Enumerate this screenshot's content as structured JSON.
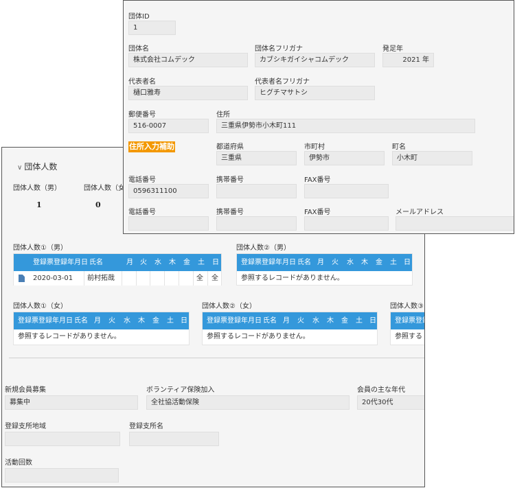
{
  "back": {
    "section_title": "団体人数",
    "count_male_label": "団体人数（男）",
    "count_female_label": "団体人数（女",
    "count_male_value": "1",
    "count_female_value": "0",
    "sub1_title": "団体人数①（男）",
    "sub2_title": "団体人数②（男）",
    "sub3_title": "団体人数①（女）",
    "sub4_title": "団体人数②（女）",
    "sub5_title": "団体人数③",
    "headers": [
      "登録票登録年月日",
      "氏名",
      "月",
      "火",
      "水",
      "木",
      "金",
      "土",
      "日"
    ],
    "row1": {
      "date": "2020-03-01",
      "name": "前村拓哉",
      "sat": "全",
      "sun": "全"
    },
    "empty": "参照するレコードがありません。",
    "empty_short": "参照する",
    "recruit_label": "新規会員募集",
    "recruit_value": "募集中",
    "insurance_label": "ボランティア保険加入",
    "insurance_value": "全社協活動保険",
    "age_label": "会員の主な年代",
    "age_value": "20代30代",
    "branch_area_label": "登録支所地域",
    "branch_name_label": "登録支所名",
    "activity_label": "活動回数"
  },
  "front": {
    "id_label": "団体ID",
    "id_value": "1",
    "name_label": "団体名",
    "name_value": "株式会社コムデック",
    "name_kana_label": "団体名フリガナ",
    "name_kana_value": "カブシキガイシャコムデック",
    "year_label": "発足年",
    "year_value": "2021 年",
    "rep_label": "代表者名",
    "rep_value": "樋口雅寿",
    "rep_kana_label": "代表者名フリガナ",
    "rep_kana_value": "ヒグチマサトシ",
    "zip_label": "郵便番号",
    "zip_value": "516-0007",
    "address_label": "住所",
    "address_value": "三重県伊勢市小木町111",
    "assist_label": "住所入力補助",
    "pref_label": "都道府県",
    "pref_value": "三重県",
    "city_label": "市町村",
    "city_value": "伊勢市",
    "town_label": "町名",
    "town_value": "小木町",
    "tel_label": "電話番号",
    "tel_value": "0596311100",
    "mobile_label": "携帯番号",
    "fax_label": "FAX番号",
    "tel2_label": "電話番号",
    "mobile2_label": "携帯番号",
    "fax2_label": "FAX番号",
    "mail_label": "メールアドレス"
  }
}
